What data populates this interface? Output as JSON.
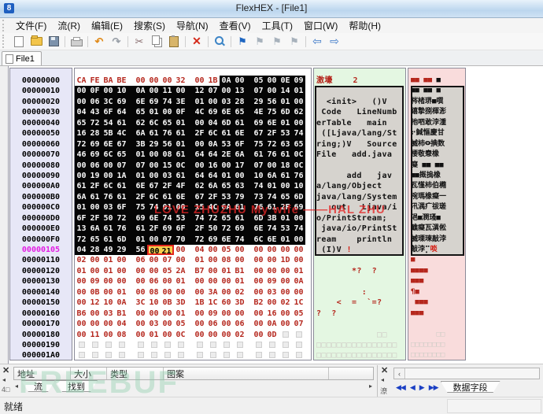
{
  "window": {
    "title": "FlexHEX - [File1]",
    "app_icon": "8"
  },
  "menu": {
    "items": [
      "文件(F)",
      "流(R)",
      "编辑(E)",
      "搜索(S)",
      "导航(N)",
      "查看(V)",
      "工具(T)",
      "窗口(W)",
      "帮助(H)"
    ]
  },
  "toolbar": {
    "buttons": [
      {
        "name": "new-file-button",
        "icon": "page-icon",
        "type": "page"
      },
      {
        "name": "open-file-button",
        "icon": "folder-icon",
        "type": "folder"
      },
      {
        "name": "save-button",
        "icon": "floppy-icon",
        "type": "floppy"
      },
      {
        "type": "sep"
      },
      {
        "name": "print-button",
        "icon": "printer-icon",
        "type": "print"
      },
      {
        "type": "sep"
      },
      {
        "name": "undo-button",
        "icon": "undo-icon",
        "type": "glyph",
        "glyph": "↶",
        "cls": "g-undo"
      },
      {
        "name": "redo-button",
        "icon": "redo-icon",
        "type": "glyph",
        "glyph": "↷",
        "cls": "g-redo"
      },
      {
        "type": "sep"
      },
      {
        "name": "cut-button",
        "icon": "scissors-icon",
        "type": "glyph",
        "glyph": "✂",
        "cls": "g-cut"
      },
      {
        "name": "copy-button",
        "icon": "copy-icon",
        "type": "copy"
      },
      {
        "name": "paste-button",
        "icon": "paste-icon",
        "type": "paste"
      },
      {
        "type": "sep"
      },
      {
        "name": "delete-button",
        "icon": "delete-icon",
        "type": "glyph",
        "glyph": "✕",
        "cls": "g-del"
      },
      {
        "type": "sep"
      },
      {
        "name": "search-button",
        "icon": "search-icon",
        "type": "mag"
      },
      {
        "type": "sep"
      },
      {
        "name": "bookmark-set-button",
        "icon": "flag-blue-icon",
        "type": "glyph",
        "glyph": "⚑",
        "cls": "g-flagb"
      },
      {
        "name": "bookmark-prev-button",
        "icon": "flag-gray-icon",
        "type": "glyph",
        "glyph": "⚑",
        "cls": "g-flagg"
      },
      {
        "name": "bookmark-next-button",
        "icon": "flag-gray-icon",
        "type": "glyph",
        "glyph": "⚑",
        "cls": "g-flagg"
      },
      {
        "name": "bookmark-clear-button",
        "icon": "flag-gray-icon",
        "type": "glyph",
        "glyph": "⚑",
        "cls": "g-flagg"
      },
      {
        "type": "sep"
      },
      {
        "name": "back-button",
        "icon": "back-arrow-icon",
        "type": "glyph",
        "glyph": "⇦",
        "cls": "g-nav"
      },
      {
        "name": "forward-button",
        "icon": "forward-arrow-icon",
        "type": "glyph",
        "glyph": "⇨",
        "cls": "g-nav"
      }
    ]
  },
  "tabs": {
    "file_tab": "File1"
  },
  "hex": {
    "rows": [
      {
        "a": "00000000",
        "hl": false,
        "b": "CA FE BA BE 00 00 00 32 00 1B 0A 00 05 00 0E 09",
        "s": "rrrrrrrrrrwwwwww"
      },
      {
        "a": "00000010",
        "hl": false,
        "b": "00 0F 00 10 0A 00 11 00 12 07 00 13 07 00 14 01",
        "s": "wwwwwwwwwwwwwwww"
      },
      {
        "a": "00000020",
        "hl": false,
        "b": "00 06 3C 69 6E 69 74 3E 01 00 03 28 29 56 01 00",
        "s": "wwwwwwwwwwwwwwww"
      },
      {
        "a": "00000030",
        "hl": false,
        "b": "04 43 6F 64 65 01 00 0F 4C 69 6E 65 4E 75 6D 62",
        "s": "wwwwwwwwwwwwwwww"
      },
      {
        "a": "00000040",
        "hl": false,
        "b": "65 72 54 61 62 6C 65 01 00 04 6D 61 69 6E 01 00",
        "s": "wwwwwwwwwwwwwwww"
      },
      {
        "a": "00000050",
        "hl": false,
        "b": "16 28 5B 4C 6A 61 76 61 2F 6C 61 6E 67 2F 53 74",
        "s": "wwwwwwwwwwwwwwww"
      },
      {
        "a": "00000060",
        "hl": false,
        "b": "72 69 6E 67 3B 29 56 01 00 0A 53 6F 75 72 63 65",
        "s": "wwwwwwwwwwwwwwww"
      },
      {
        "a": "00000070",
        "hl": false,
        "b": "46 69 6C 65 01 00 08 61 64 64 2E 6A 61 76 61 0C",
        "s": "wwwwwwwwwwwwwwww"
      },
      {
        "a": "00000080",
        "hl": false,
        "b": "00 06 00 07 07 00 15 0C 00 16 00 17 07 00 18 0C",
        "s": "wwwwwwwwwwwwwwww"
      },
      {
        "a": "00000090",
        "hl": false,
        "b": "00 19 00 1A 01 00 03 61 64 64 01 00 10 6A 61 76",
        "s": "wwwwwwwwwwwwwwww"
      },
      {
        "a": "000000A0",
        "hl": false,
        "b": "61 2F 6C 61 6E 67 2F 4F 62 6A 65 63 74 01 00 10",
        "s": "wwwwwwwwwwwwwwww"
      },
      {
        "a": "000000B0",
        "hl": false,
        "b": "6A 61 76 61 2F 6C 61 6E 67 2F 53 79 73 74 65 6D",
        "s": "wwwwwwwwwwwwwwww"
      },
      {
        "a": "000000C0",
        "hl": false,
        "b": "01 00 03 6F 75 74 01 00 15 4C 6A 61 76 61 2F 69",
        "s": "wwwwwwwwwwwwwwww"
      },
      {
        "a": "000000D0",
        "hl": false,
        "b": "6F 2F 50 72 69 6E 74 53 74 72 65 61 6D 3B 01 00",
        "s": "wwwwwwwwwwwwwwww"
      },
      {
        "a": "000000E0",
        "hl": false,
        "b": "13 6A 61 76 61 2F 69 6F 2F 50 72 69 6E 74 53 74",
        "s": "wwwwwwwwwwwwwwww"
      },
      {
        "a": "000000F0",
        "hl": false,
        "b": "72 65 61 6D 01 00 07 70 72 69 6E 74 6C 6E 01 00",
        "s": "wwwwwwwwwwwwwwww"
      },
      {
        "a": "00000105",
        "hl": true,
        "b": "04 28 49 29 56 00 21 00 04 00 05 00 00 00 00 00",
        "s": "wwwwwssrrrrrrrrr"
      },
      {
        "a": "00000110",
        "hl": false,
        "b": "02 00 01 00 06 00 07 00 01 00 08 00 00 00 1D 00",
        "s": "rrrrrrrrrrrrrrrr"
      },
      {
        "a": "00000120",
        "hl": false,
        "b": "01 00 01 00 00 00 05 2A B7 00 01 B1 00 00 00 01",
        "s": "rrrrrrrrrrrrrrrr"
      },
      {
        "a": "00000130",
        "hl": false,
        "b": "00 09 00 00 00 06 00 01 00 00 00 01 00 09 00 0A",
        "s": "rrrrrrrrrrrrrrrr"
      },
      {
        "a": "00000140",
        "hl": false,
        "b": "00 0B 00 01 00 08 00 00 00 3A 00 02 00 03 00 00",
        "s": "rrrrrrrrrrrrrrrr"
      },
      {
        "a": "00000150",
        "hl": false,
        "b": "00 12 10 0A 3C 10 0B 3D 1B 1C 60 3D B2 00 02 1C",
        "s": "rrrrrrrrrrrrrrrr"
      },
      {
        "a": "00000160",
        "hl": false,
        "b": "B6 00 03 B1 00 00 00 01 00 09 00 00 00 16 00 05",
        "s": "rrrrrrrrrrrrrrrr"
      },
      {
        "a": "00000170",
        "hl": false,
        "b": "00 00 00 04 00 03 00 05 00 06 00 06 00 0A 00 07",
        "s": "rrrrrrrrrrrrrrrr"
      },
      {
        "a": "00000180",
        "hl": false,
        "b": "00 11 00 08 00 01 00 0C 00 00 00 02 00 0D -- --",
        "s": "rrrrrrrrrrrrrree"
      },
      {
        "a": "00000190",
        "hl": false,
        "b": "-- -- -- -- -- -- -- -- -- -- -- -- -- -- -- --",
        "s": "eeeeeeeeeeeeeeee"
      },
      {
        "a": "000001A0",
        "hl": false,
        "b": "-- -- -- -- -- -- -- -- -- -- -- -- -- -- -- --",
        "s": "eeeeeeeeeeeeeeee"
      }
    ]
  },
  "ascii": {
    "lines": [
      [
        [
          "激壕    2",
          "r"
        ]
      ],
      [
        [
          " ",
          "g"
        ]
      ],
      [
        [
          "  <init>   ()V",
          "g"
        ]
      ],
      [
        [
          " Code   LineNumb",
          "g"
        ]
      ],
      [
        [
          "erTable   main",
          "g"
        ]
      ],
      [
        [
          " ([Ljava/lang/St",
          "g"
        ]
      ],
      [
        [
          "ring;)V   Source",
          "g"
        ]
      ],
      [
        [
          "File   add.java",
          "g"
        ]
      ],
      [
        [
          " ",
          "g"
        ]
      ],
      [
        [
          "      add   jav",
          "g"
        ]
      ],
      [
        [
          "a/lang/Object",
          "g"
        ]
      ],
      [
        [
          "java/lang/System",
          "g"
        ]
      ],
      [
        [
          "   out   Ljava/i",
          "g"
        ]
      ],
      [
        [
          "o/PrintStream;",
          "g"
        ]
      ],
      [
        [
          " java/io/PrintSt",
          "g"
        ]
      ],
      [
        [
          "ream    println",
          "g"
        ]
      ],
      [
        [
          " (I)V ",
          "g"
        ],
        [
          "!",
          "rb"
        ]
      ],
      [
        [
          "",
          "r"
        ]
      ],
      [
        [
          "       *?  ?",
          "r"
        ]
      ],
      [
        [
          "",
          "r"
        ]
      ],
      [
        [
          "         :",
          "r"
        ]
      ],
      [
        [
          "    <  =  `=?",
          "r"
        ]
      ],
      [
        [
          "?  ?",
          "r"
        ]
      ],
      [
        [
          "",
          "r"
        ]
      ],
      [
        [
          "            ",
          "r"
        ],
        [
          "□□",
          "p"
        ]
      ],
      [
        [
          "□□□□□□□□□□□□□□□□",
          "p"
        ]
      ],
      [
        [
          "□□□□□□□□□□□□□□□□",
          "p"
        ]
      ]
    ]
  },
  "unicode": {
    "lines": [
      [
        [
          "■■ ■■",
          "r"
        ],
        [
          " ■",
          "g"
        ]
      ],
      [
        [
          "■■ ■■ ■",
          "g"
        ]
      ],
      [
        [
          "梣楮琾■噀",
          "g"
        ]
      ],
      [
        [
          "繥摯捌楎浵",
          "g"
        ]
      ],
      [
        [
          "扡呬敢浡湩",
          "g"
        ]
      ],
      [
        [
          "⠖䱛慪慶⽢",
          "g"
        ]
      ],
      [
        [
          "楲杮⭖捵数",
          "g"
        ]
      ],
      [
        [
          "楆敬憃⹤橡",
          "g"
        ]
      ],
      [
        [
          "癡 ■■ ■■",
          "g"
        ]
      ],
      [
        [
          "■■摡摀橡",
          "g"
        ]
      ],
      [
        [
          "⽡慬杮伯橢",
          "g"
        ]
      ],
      [
        [
          "捥瑪橡癡⼀",
          "g"
        ]
      ],
      [
        [
          "汛湡⽧祓瑳",
          "g"
        ]
      ],
      [
        [
          "浥■潣瑵■",
          "g"
        ]
      ],
      [
        [
          "䩌癡⽡潩倯",
          "g"
        ]
      ],
      [
        [
          "楲瑮瑓敲浡",
          "g"
        ]
      ],
      [
        [
          "敲浡⡉",
          "g"
        ],
        [
          "啖",
          "rb"
        ]
      ],
      [
        [
          "■",
          "r"
        ]
      ],
      [
        [
          "■■■■",
          "r"
        ]
      ],
      [
        [
          "■■■",
          "r"
        ]
      ],
      [
        [
          "¶■",
          "r"
        ]
      ],
      [
        [
          " ■■■",
          "r"
        ]
      ],
      [
        [
          "■■■",
          "r"
        ]
      ],
      [
        [
          "",
          "r"
        ]
      ],
      [
        [
          "      ",
          "r"
        ],
        [
          "□□",
          "p"
        ]
      ],
      [
        [
          "□□□□□□□□",
          "p"
        ]
      ],
      [
        [
          "□□□□□□□□",
          "p"
        ]
      ]
    ]
  },
  "dock_left": {
    "close_glyph": "✕",
    "collapse_glyph": "◂",
    "side_label": "4□",
    "headers": [
      "地址",
      "大小",
      "类型",
      "图案"
    ],
    "header_widths": [
      72,
      46,
      72,
      210
    ],
    "tabs": [
      "流",
      "找到"
    ],
    "scroll_left_glyph": "◂",
    "scroll_right_glyph": "▸"
  },
  "dock_right": {
    "close_glyph": "✕",
    "collapse_glyph": "◂",
    "side_label": "潦",
    "scroll_left_glyph": "‹",
    "nav": [
      "◀◀",
      "◀",
      "▶",
      "▶▶"
    ],
    "tab": "数据字段"
  },
  "status": {
    "ready": "就绪"
  },
  "watermarks": {
    "love": "LOVE ZHUZHU My wife ——HAL ZHU",
    "freebuf": "FREEBUF"
  },
  "colors": {
    "hex_red": "#b5271d",
    "selection_border": "#e2261d",
    "selection_fill": "#f6cf4e",
    "address_highlight": "#e31ae3",
    "ascii_bg": "#e4f7e2",
    "unicode_bg": "#f9dcdc",
    "address_bg": "#e7e7f7",
    "hex_black_bg": "#050505"
  }
}
